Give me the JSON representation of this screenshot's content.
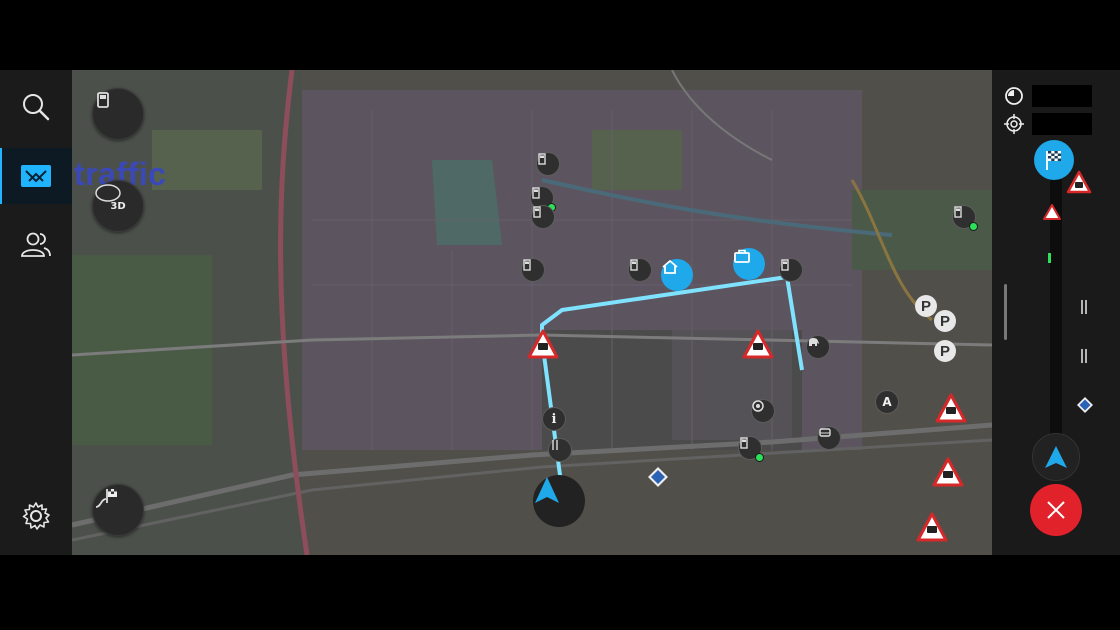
{
  "sidebar": {
    "items": [
      {
        "name": "search",
        "icon": "search-icon"
      },
      {
        "name": "map-layers",
        "icon": "map-layers-icon",
        "active": true
      },
      {
        "name": "contacts",
        "icon": "people-icon"
      },
      {
        "name": "settings",
        "icon": "gear-icon"
      }
    ]
  },
  "map": {
    "overlay_label": "traffic",
    "buttons": {
      "fuel": "fuel-icon",
      "view_mode": "3D",
      "route_plan": "route-flag-icon"
    },
    "parking_label": "P",
    "info_label": "i",
    "poi_letter": "A",
    "accent_color": "#1fa8ea",
    "route_color": "#7fe3ff"
  },
  "right_panel": {
    "eta_icon": "clock-icon",
    "location_icon": "crosshair-icon",
    "destination_icon": "checkered-flag-icon",
    "cancel_icon": "close-icon",
    "cancel_color": "#e2222a"
  }
}
